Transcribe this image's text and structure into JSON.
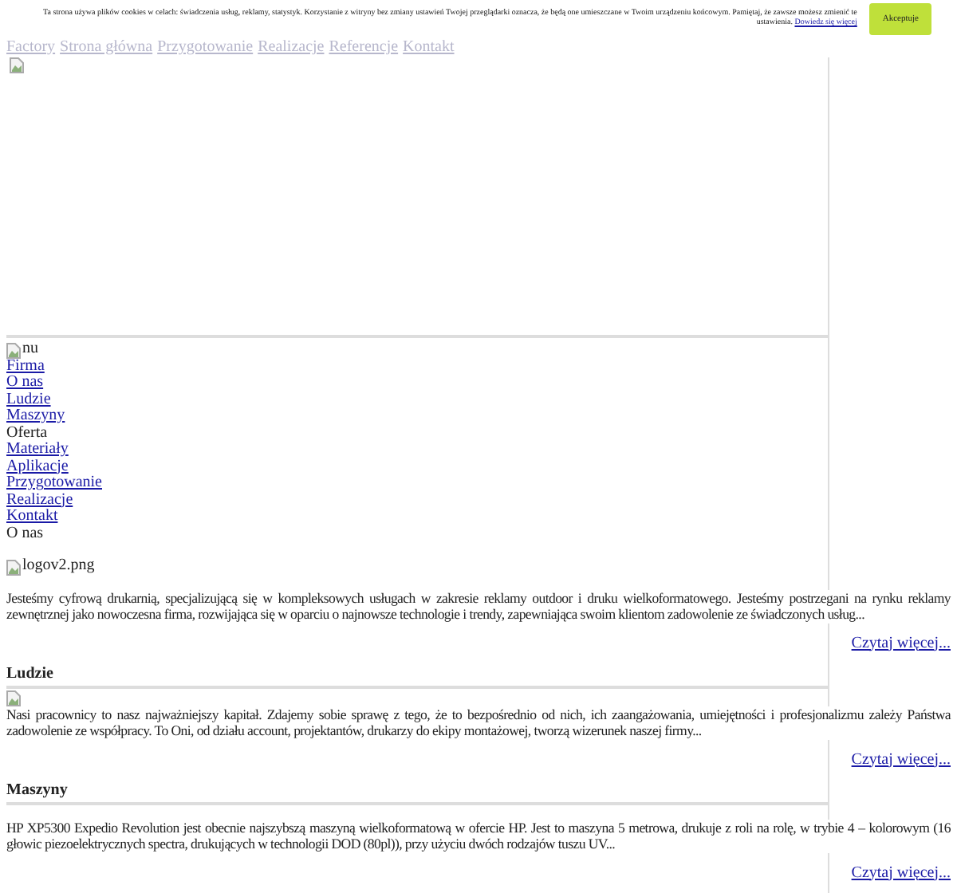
{
  "cookie_bar": {
    "text": "Ta strona używa plików cookies w celach: świadczenia usług, reklamy, statystyk. Korzystanie z witryny bez zmiany ustawień Twojej przeglądarki oznacza, że będą one umieszczane w Twoim urządzeniu końcowym. Pamiętaj, że zawsze możesz zmienić te ustawienia.",
    "link": "Dowiedz się więcej",
    "button": "Akceptuje"
  },
  "nav": {
    "items": [
      "Factory",
      "Strona główna",
      "Przygotowanie",
      "Realizacje",
      "Referencje",
      "Kontakt"
    ]
  },
  "menu": {
    "image_alt": "nu",
    "items": [
      {
        "label": "Firma",
        "kind": "link"
      },
      {
        "label": "O nas",
        "kind": "link"
      },
      {
        "label": "Ludzie",
        "kind": "link"
      },
      {
        "label": "Maszyny",
        "kind": "link"
      },
      {
        "label": "Oferta",
        "kind": "text"
      },
      {
        "label": "Materiały",
        "kind": "link"
      },
      {
        "label": "Aplikacje",
        "kind": "link"
      },
      {
        "label": "Przygotowanie",
        "kind": "link"
      },
      {
        "label": "Realizacje",
        "kind": "link"
      },
      {
        "label": "Kontakt",
        "kind": "link"
      },
      {
        "label": "O nas",
        "kind": "text"
      }
    ]
  },
  "logo_alt": "logov2.png",
  "sections": [
    {
      "body": "Jesteśmy cyfrową drukarnią, specjalizującą się w kompleksowych usługach w zakresie reklamy outdoor i druku wielkoformatowego. Jesteśmy postrzegani na rynku reklamy zewnętrznej jako nowoczesna firma, rozwijająca się w oparciu o najnowsze technologie i trendy, zapewniająca swoim klientom zadowolenie ze świadczonych usług...",
      "more": "Czytaj więcej..."
    },
    {
      "heading": "Ludzie",
      "image": true,
      "body": "Nasi pracownicy to nasz najważniejszy kapitał. Zdajemy sobie sprawę z tego, że to bezpośrednio od nich, ich zaangażowania, umiejętności i profesjonalizmu zależy Państwa zadowolenie ze współpracy. To Oni, od działu account, projektantów, drukarzy do ekipy montażowej, tworzą wizerunek naszej firmy...",
      "more": "Czytaj więcej..."
    },
    {
      "heading": "Maszyny",
      "body": "HP XP5300 Expedio Revolution jest obecnie najszybszą maszyną wielkoformatową w ofercie HP. Jest to maszyna 5 metrowa, drukuje z roli na rolę, w trybie 4 – kolorowym (16 głowic piezoelektrycznych spectra, drukujących w technologii DOD (80pl)), przy użyciu dwóch rodzajów tuszu UV...",
      "more": "Czytaj więcej..."
    }
  ]
}
